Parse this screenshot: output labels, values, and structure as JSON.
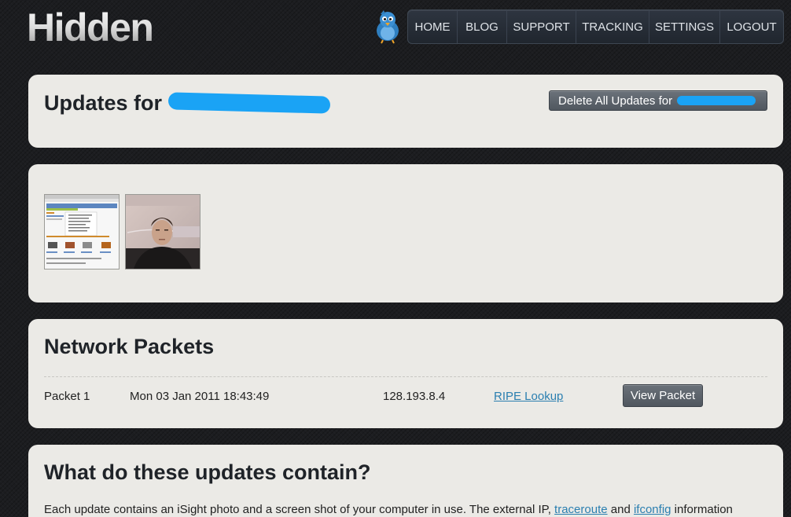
{
  "brand": {
    "logo_text": "Hidden"
  },
  "nav": {
    "items": [
      "HOME",
      "BLOG",
      "SUPPORT",
      "TRACKING",
      "SETTINGS",
      "LOGOUT"
    ]
  },
  "updates": {
    "title_prefix": "Updates for",
    "delete_button_prefix": "Delete All Updates for"
  },
  "images": {
    "screenshot_thumbnail": "screenshot-thumbnail",
    "photo_thumbnail": "isight-photo-thumbnail"
  },
  "network": {
    "title": "Network Packets",
    "packets": [
      {
        "name": "Packet 1",
        "date": "Mon 03 Jan 2011 18:43:49",
        "ip": "128.193.8.4",
        "lookup_label": "RIPE Lookup",
        "view_label": "View Packet"
      }
    ]
  },
  "info": {
    "title": "What do these updates contain?",
    "text_start": "Each update contains an iSight photo and a screen shot of your computer in use. The external IP,",
    "link_traceroute": "traceroute",
    "text_and": "and",
    "link_ifconfig": "ifconfig",
    "text_end": "information"
  },
  "colors": {
    "background": "#1c1d20",
    "panel": "#ebeae6",
    "link": "#2b7fb0",
    "redaction": "#1aa3f5",
    "button": "#5d646c"
  },
  "icons": {
    "mascot": "bluebird-icon"
  }
}
